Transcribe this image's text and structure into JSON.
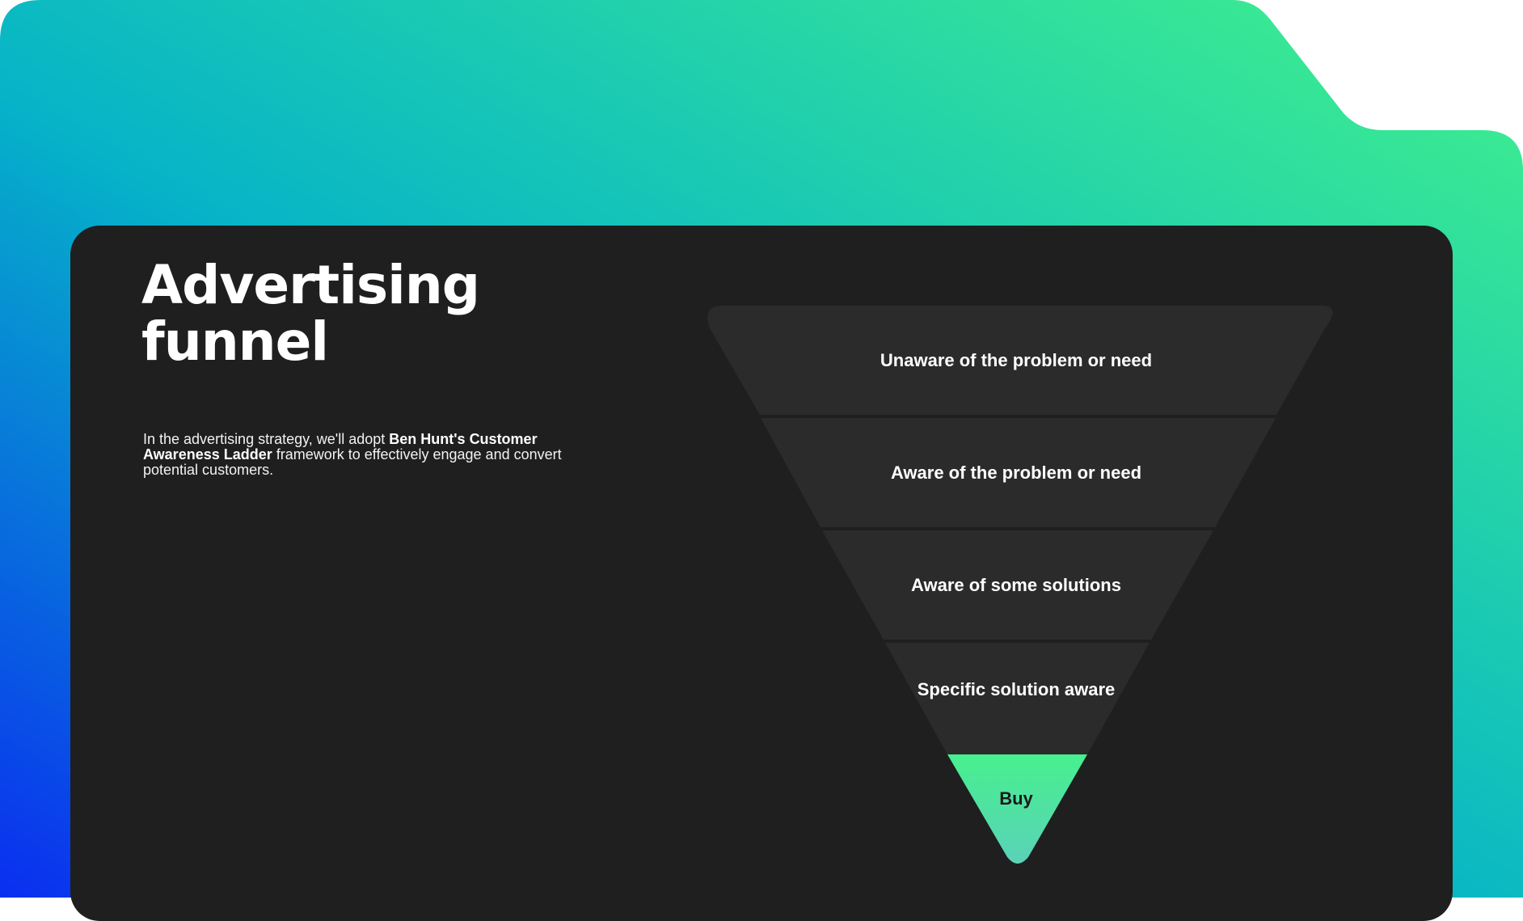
{
  "slide": {
    "title_line1": "Advertising",
    "title_line2": "funnel",
    "description": {
      "part1": "In the advertising strategy, we'll adopt ",
      "highlight": "Ben Hunt's Customer Awareness Ladder",
      "part2": " framework to effectively engage and convert potential customers."
    }
  },
  "funnel": {
    "stages": [
      "Unaware of the problem or need",
      "Aware of the problem or need",
      "Aware of some solutions",
      "Specific solution aware",
      "Buy"
    ]
  },
  "colors": {
    "background_gradient": [
      "#0a36e8",
      "#06b6c8",
      "#3df08f"
    ],
    "panel": "#1f1f1f",
    "stage_fill": "#2b2b2b",
    "stage_text": "#ffffff",
    "buy_gradient": [
      "#47f08e",
      "#5ad2b8"
    ],
    "buy_text": "#1a1a1a"
  }
}
